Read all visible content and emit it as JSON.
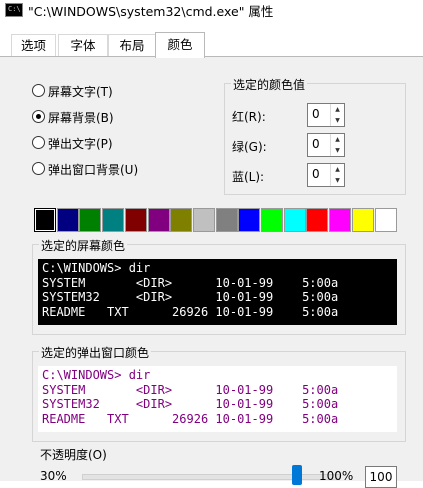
{
  "window": {
    "icon_text": "C:\\",
    "title": "\"C:\\WINDOWS\\system32\\cmd.exe\" 属性"
  },
  "tabs": [
    {
      "label": "选项",
      "active": false
    },
    {
      "label": "字体",
      "active": false
    },
    {
      "label": "布局",
      "active": false
    },
    {
      "label": "颜色",
      "active": true
    }
  ],
  "color_targets": [
    {
      "label": "屏幕文字(T)",
      "checked": false
    },
    {
      "label": "屏幕背景(B)",
      "checked": true
    },
    {
      "label": "弹出文字(P)",
      "checked": false
    },
    {
      "label": "弹出窗口背景(U)",
      "checked": false
    }
  ],
  "selected_color": {
    "group_title": "选定的颜色值",
    "red_label": "红(R):",
    "red_value": "0",
    "green_label": "绿(G):",
    "green_value": "0",
    "blue_label": "蓝(L):",
    "blue_value": "0"
  },
  "palette": {
    "colors": [
      "#000000",
      "#000080",
      "#008000",
      "#008080",
      "#800000",
      "#800080",
      "#808000",
      "#c0c0c0",
      "#808080",
      "#0000ff",
      "#00ff00",
      "#00ffff",
      "#ff0000",
      "#ff00ff",
      "#ffff00",
      "#ffffff"
    ],
    "selected_index": 0
  },
  "screen_preview": {
    "group_title": "选定的屏幕颜色",
    "text_color": "#ffffff",
    "background_color": "#000000",
    "lines": [
      "C:\\WINDOWS> dir",
      "SYSTEM       <DIR>      10-01-99    5:00a",
      "SYSTEM32     <DIR>      10-01-99    5:00a",
      "README   TXT      26926 10-01-99    5:00a"
    ]
  },
  "popup_preview": {
    "group_title": "选定的弹出窗口颜色",
    "text_color": "#800080",
    "background_color": "#ffffff",
    "lines": [
      "C:\\WINDOWS> dir",
      "SYSTEM       <DIR>      10-01-99    5:00a",
      "SYSTEM32     <DIR>      10-01-99    5:00a",
      "README   TXT      26926 10-01-99    5:00a"
    ]
  },
  "opacity": {
    "label": "不透明度(O)",
    "min_label": "30%",
    "max_label": "100%",
    "value": "100",
    "level": 1.0
  }
}
